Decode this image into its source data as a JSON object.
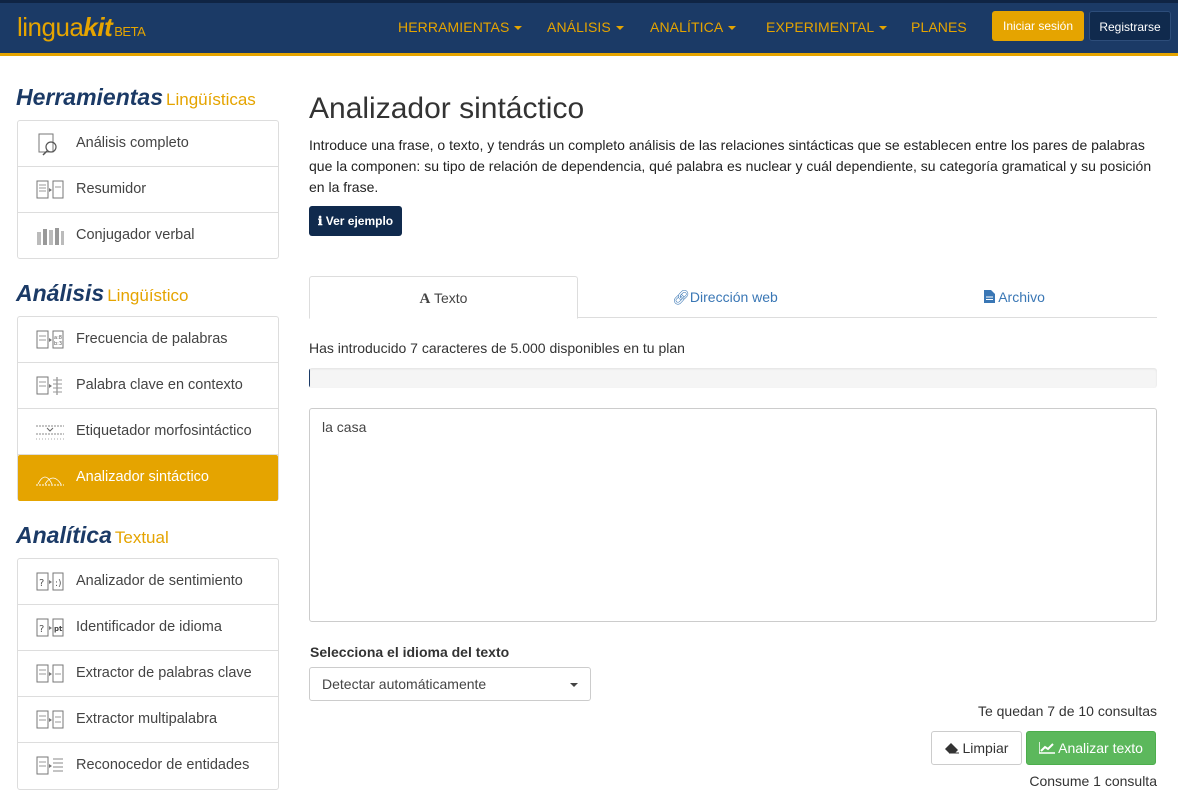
{
  "brand": {
    "name_part1": "lingua",
    "name_part2": "kit",
    "badge": "BETA"
  },
  "nav": {
    "items": [
      "HERRAMIENTAS",
      "ANÁLISIS",
      "ANALÍTICA",
      "EXPERIMENTAL",
      "PLANES"
    ],
    "login": "Iniciar sesión",
    "register": "Registrarse"
  },
  "sidebar": {
    "sections": [
      {
        "title": "Herramientas",
        "subtitle": "Lingüísticas",
        "items": [
          "Análisis completo",
          "Resumidor",
          "Conjugador verbal"
        ]
      },
      {
        "title": "Análisis",
        "subtitle": "Lingüístico",
        "items": [
          "Frecuencia de palabras",
          "Palabra clave en contexto",
          "Etiquetador morfosintáctico",
          "Analizador sintáctico"
        ]
      },
      {
        "title": "Analítica",
        "subtitle": "Textual",
        "items": [
          "Analizador de sentimiento",
          "Identificador de idioma",
          "Extractor de palabras clave",
          "Extractor multipalabra",
          "Reconocedor de entidades"
        ]
      }
    ],
    "active_item": "Analizador sintáctico"
  },
  "main": {
    "title": "Analizador sintáctico",
    "intro": "Introduce una frase, o texto, y tendrás un completo análisis de las relaciones sintácticas que se establecen entre los pares de palabras que la componen: su tipo de relación de dependencia, qué palabra es nuclear y cuál dependiente, su categoría gramatical y su posición en la frase.",
    "example_button": "Ver ejemplo",
    "tabs": [
      "Texto",
      "Dirección web",
      "Archivo"
    ],
    "char_count_text": "Has introducido 7 caracteres de 5.000 disponibles en tu plan",
    "usage_fraction": 0.0014,
    "text_value": "la casa",
    "language_label": "Selecciona el idioma del texto",
    "language_selected": "Detectar automáticamente",
    "remaining_text": "Te quedan 7 de 10 consultas",
    "clear_button": "Limpiar",
    "analyze_button": "Analizar texto",
    "consume_text": "Consume 1 consulta"
  },
  "colors": {
    "navy": "#1b3a66",
    "accent": "#e5a400",
    "success": "#5cb85c",
    "link": "#3a77b5"
  }
}
